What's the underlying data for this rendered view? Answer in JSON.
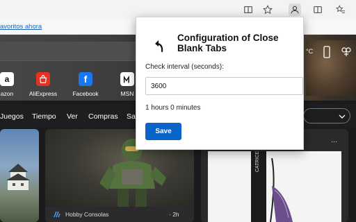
{
  "favorites_bar": {
    "link_text": "avoritos ahora"
  },
  "hero": {
    "weather_fragment": "°C"
  },
  "shortcuts": [
    {
      "label": "azon",
      "icon": "amazon-icon",
      "glyph": "a",
      "color": "#ffffff",
      "bg": "#ffffff",
      "fg": "#111111"
    },
    {
      "label": "AliExpress",
      "icon": "aliexpress-icon",
      "glyph": "🛍",
      "bg": "#e43225",
      "fg": "#ffffff"
    },
    {
      "label": "Facebook",
      "icon": "facebook-icon",
      "glyph": "f",
      "bg": "#1877f2",
      "fg": "#ffffff"
    },
    {
      "label": "MSN",
      "icon": "msn-icon",
      "glyph": "",
      "bg": "#ffffff",
      "fg": "#111111"
    }
  ],
  "nav": {
    "items": [
      "Juegos",
      "Tiempo",
      "Ver",
      "Compras",
      "Sa"
    ]
  },
  "feed": {
    "card2": {
      "source": "Hobby Consolas",
      "time": "· 2h"
    },
    "card3": {
      "menu": "..."
    }
  },
  "popup": {
    "title": "Configuration of Close Blank Tabs",
    "interval_label": "Check interval (seconds):",
    "interval_value": "3600",
    "duration_text": "1 hours 0 minutes",
    "save_label": "Save",
    "accent": "#0a63c9"
  }
}
